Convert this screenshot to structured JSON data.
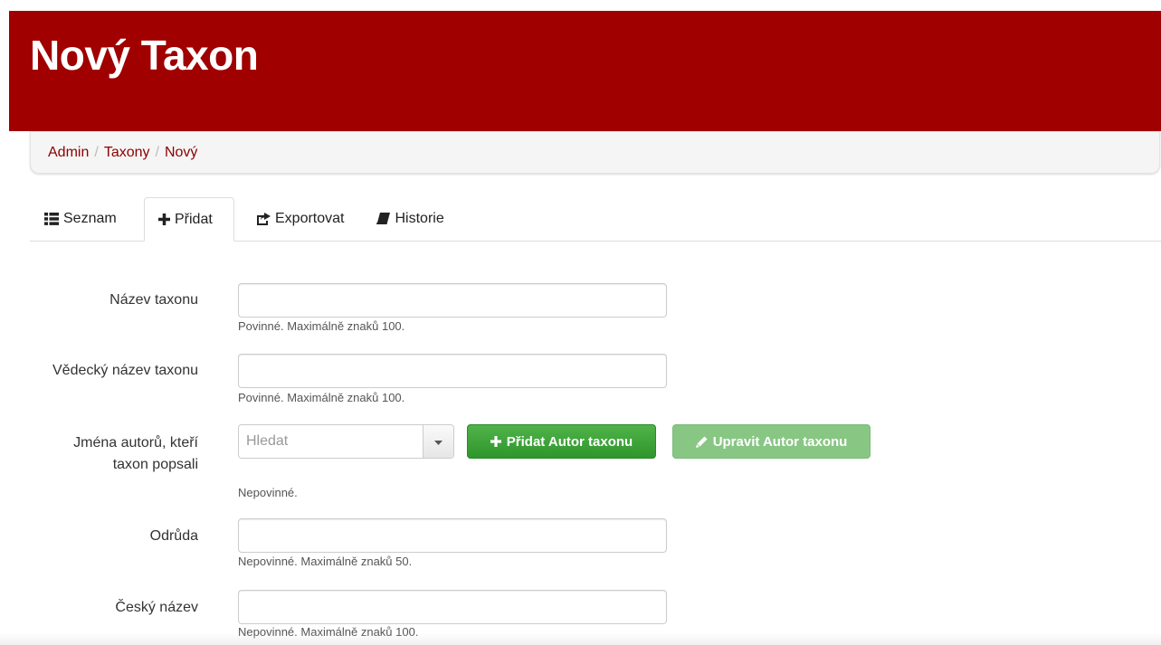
{
  "header": {
    "title": "Nový Taxon"
  },
  "breadcrumb": {
    "items": [
      "Admin",
      "Taxony",
      "Nový"
    ],
    "separator": "/"
  },
  "tabs": [
    {
      "label": "Seznam",
      "icon": "list-icon"
    },
    {
      "label": "Přidat",
      "icon": "plus-icon",
      "active": true
    },
    {
      "label": "Exportovat",
      "icon": "share-icon"
    },
    {
      "label": "Historie",
      "icon": "book-icon"
    }
  ],
  "form": {
    "name": {
      "label": "Název taxonu",
      "value": "",
      "help": "Povinné. Maximálně znaků 100."
    },
    "scientific": {
      "label": "Vědecký název taxonu",
      "value": "",
      "help": "Povinné. Maximálně znaků 100."
    },
    "authors": {
      "label_line1": "Jména autorů, kteří",
      "label_line2": "taxon popsali",
      "placeholder": "Hledat",
      "help": "Nepovinné.",
      "add_button": "Přidat Autor taxonu",
      "edit_button": "Upravit Autor taxonu"
    },
    "variety": {
      "label": "Odrůda",
      "value": "",
      "help": "Nepovinné. Maximálně znaků 50."
    },
    "czech": {
      "label": "Český název",
      "value": "",
      "help": "Nepovinné. Maximálně znaků 100."
    }
  },
  "colors": {
    "header": "#a00000",
    "link": "#8b0000",
    "add_button": "#3ca237",
    "edit_button": "#88c684"
  }
}
